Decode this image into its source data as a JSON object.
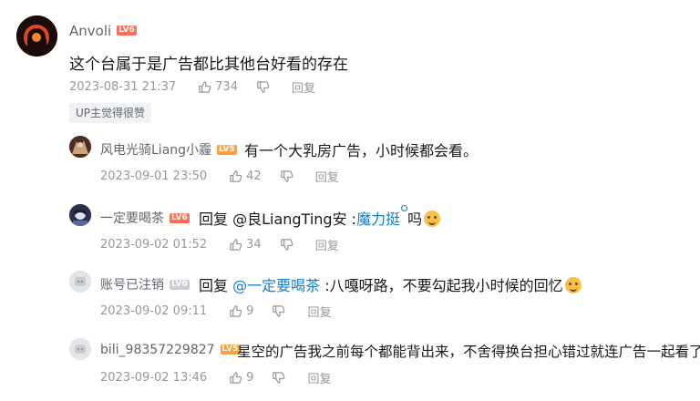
{
  "comments": [
    {
      "user": "Anvoli",
      "level": "LV6",
      "text": "这个台属于是广告都比其他台好看的存在",
      "time": "2023-08-31 21:37",
      "likes": "734",
      "reply_label": "回复",
      "badge": "UP主觉得很赞"
    }
  ],
  "replies": [
    {
      "user": "风电光骑Liang小霾",
      "level": "LV5",
      "text": "有一个大乳房广告，小时候都会看。",
      "time": "2023-09-01 23:50",
      "likes": "42",
      "reply_label": "回复"
    },
    {
      "user": "一定要喝茶",
      "level": "LV6",
      "prefix": "回复 @良LiangTing安 :",
      "link": "魔力挺",
      "suffix": "吗",
      "time": "2023-09-02 01:52",
      "likes": "34",
      "reply_label": "回复"
    },
    {
      "user": "账号已注销",
      "level": "LV0",
      "prefix": "回复 ",
      "link": "@一定要喝茶",
      "suffix": " :八嘎呀路，不要勾起我小时候的回忆",
      "time": "2023-09-02 09:11",
      "likes": "9",
      "reply_label": "回复"
    },
    {
      "user": "bili_98357229827",
      "level": "LV5",
      "text": "星空的广告我之前每个都能背出来，不舍得换台担心错过就连广告一起看了",
      "time": "2023-09-02 13:46",
      "likes": "9",
      "reply_label": "回复"
    }
  ],
  "colors": {
    "link": "#0f7ec9",
    "meta": "#9499a0",
    "username": "#61666d",
    "lv6": "#ff6c57",
    "lv5": "#ff9f3c",
    "lv0": "#c9ccd0"
  }
}
